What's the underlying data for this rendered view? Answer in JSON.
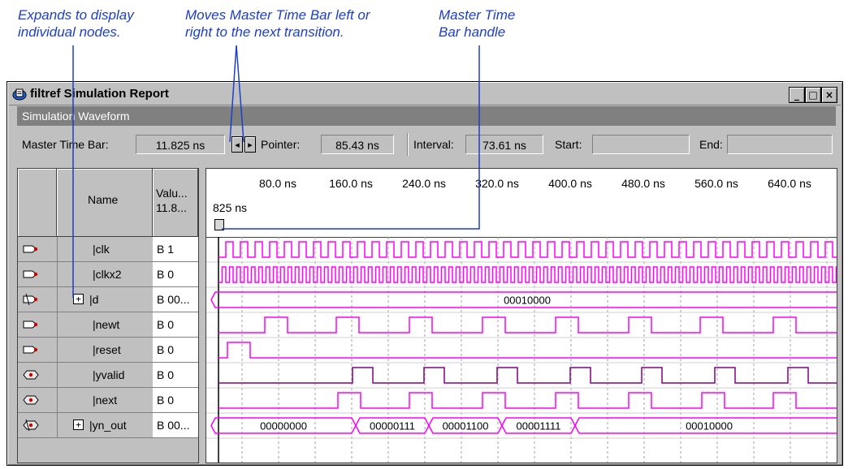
{
  "annotations": [
    {
      "lines": [
        "Expands to display",
        "individual nodes."
      ]
    },
    {
      "lines": [
        "Moves Master Time Bar left or",
        "right to the next transition."
      ]
    },
    {
      "lines": [
        "Master Time",
        "Bar handle"
      ]
    }
  ],
  "window": {
    "title": "filtref Simulation Report",
    "controls": {
      "minimize": "_",
      "maximize": "□",
      "close": "×"
    }
  },
  "section_title": "Simulation Waveform",
  "toolbar": {
    "master_label": "Master Time Bar:",
    "master_value": "11.825 ns",
    "left_arrow": "◂",
    "right_arrow": "▸",
    "pointer_label": "Pointer:",
    "pointer_value": "85.43 ns",
    "interval_label": "Interval:",
    "interval_value": "73.61 ns",
    "start_label": "Start:",
    "start_value": "",
    "end_label": "End:",
    "end_value": ""
  },
  "table": {
    "name_header": "Name",
    "value_header_line1": "Valu...",
    "value_header_line2": "11.8...",
    "rows": [
      {
        "name": "|clk",
        "value": "B 1",
        "icon": "input-pin-icon",
        "expandable": false
      },
      {
        "name": "|clkx2",
        "value": "B 0",
        "icon": "input-pin-icon",
        "expandable": false
      },
      {
        "name": "|d",
        "value": "B 00...",
        "icon": "input-bus-icon",
        "expandable": true
      },
      {
        "name": "|newt",
        "value": "B 0",
        "icon": "input-pin-icon",
        "expandable": false
      },
      {
        "name": "|reset",
        "value": "B 0",
        "icon": "input-pin-icon",
        "expandable": false
      },
      {
        "name": "|yvalid",
        "value": "B 0",
        "icon": "output-pin-icon",
        "expandable": false
      },
      {
        "name": "|next",
        "value": "B 0",
        "icon": "output-pin-icon",
        "expandable": false
      },
      {
        "name": "|yn_out",
        "value": "B 00...",
        "icon": "output-bus-icon",
        "expandable": true
      }
    ]
  },
  "timeline": {
    "ticks": [
      "80.0 ns",
      "160.0 ns",
      "240.0 ns",
      "320.0 ns",
      "400.0 ns",
      "480.0 ns",
      "560.0 ns",
      "640.0 ns"
    ],
    "master_time_marker": "825 ns"
  },
  "waveforms": {
    "d_bus_value": "00010000",
    "yn_out_values": [
      "00000000",
      "00000111",
      "00001100",
      "00001111",
      "00010000"
    ]
  },
  "colors": {
    "annotation": "#1d3fc9",
    "input_wave": "#ff00ff",
    "output_wave": "#800080",
    "bus_wave": "#ff00ff"
  }
}
